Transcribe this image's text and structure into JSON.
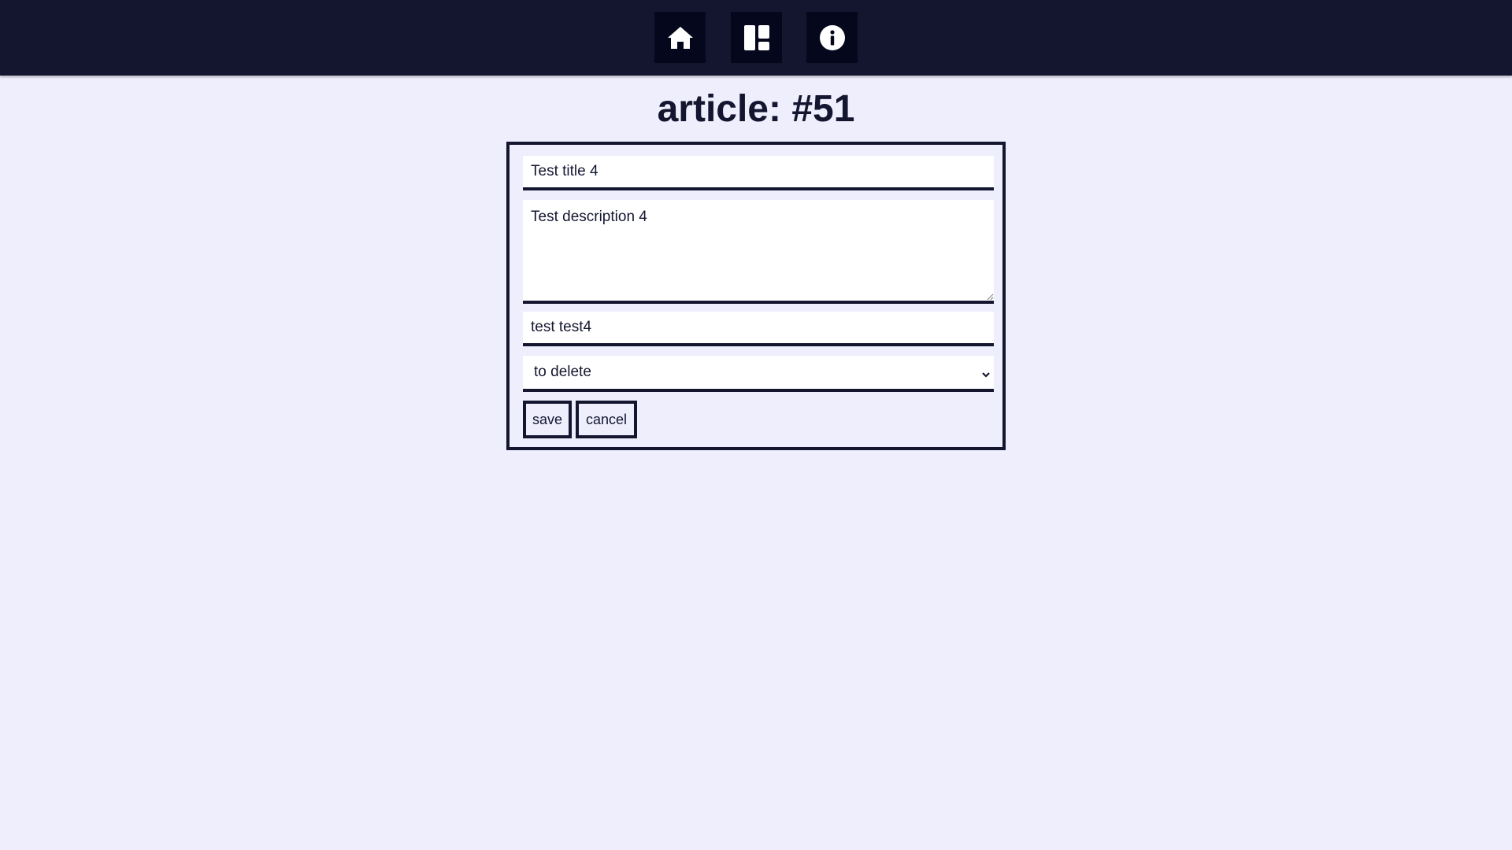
{
  "nav": {
    "items": [
      {
        "icon": "home-icon"
      },
      {
        "icon": "dashboard-icon"
      },
      {
        "icon": "info-icon"
      }
    ]
  },
  "page": {
    "title": "article: #51"
  },
  "form": {
    "title_value": "Test title 4",
    "description_value": "Test description 4",
    "tags_value": "test test4",
    "status_selected": "to delete",
    "save_label": "save",
    "cancel_label": "cancel"
  },
  "colors": {
    "background": "#eeeefc",
    "topbar": "#141630",
    "nav_button": "#05071c",
    "ink": "#141630",
    "field_bg": "#ffffff"
  }
}
